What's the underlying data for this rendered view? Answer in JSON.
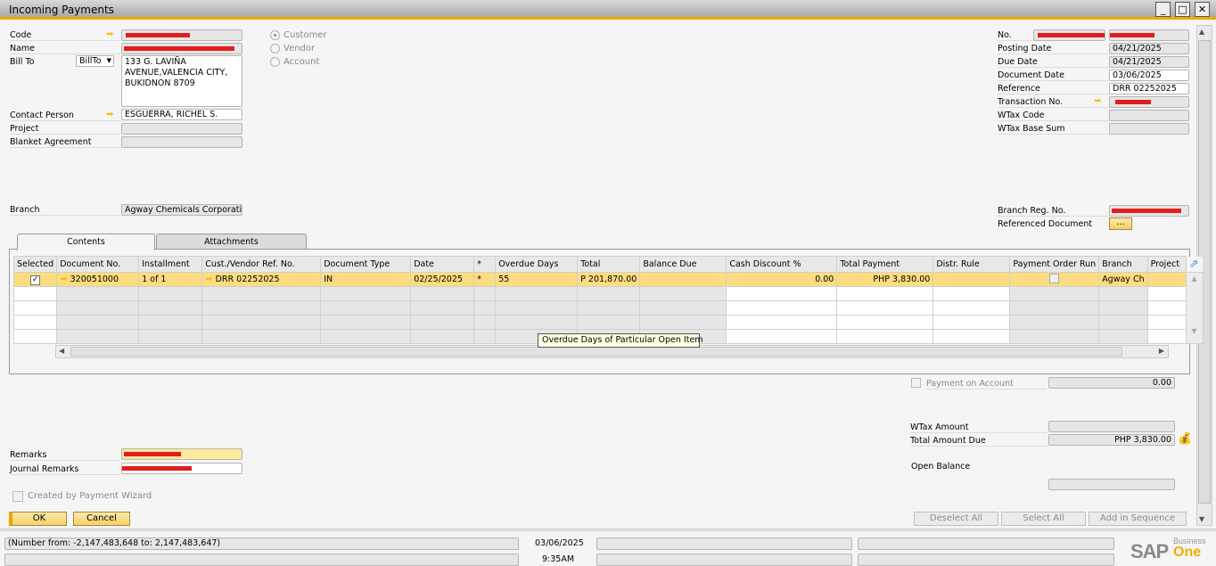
{
  "window": {
    "title": "Incoming Payments",
    "minimize": "_",
    "maximize": "□",
    "close": "✕"
  },
  "header_left": {
    "code_label": "Code",
    "name_label": "Name",
    "bill_to_label": "Bill To",
    "bill_to_select": "BillTo",
    "bill_to_address": [
      "133 G. LAVIÑA",
      "AVENUE,VALENCIA CITY,",
      "BUKIDNON 8709"
    ],
    "contact_label": "Contact Person",
    "contact_value": "ESGUERRA, RICHEL S.",
    "project_label": "Project",
    "blanket_label": "Blanket Agreement",
    "branch_label": "Branch",
    "branch_value": "Agway Chemicals Corporation"
  },
  "partner_type": {
    "options": [
      "Customer",
      "Vendor",
      "Account"
    ],
    "selected": "Customer"
  },
  "header_right": {
    "no_label": "No.",
    "posting_date_label": "Posting Date",
    "posting_date": "04/21/2025",
    "due_date_label": "Due Date",
    "due_date": "04/21/2025",
    "document_date_label": "Document Date",
    "document_date": "03/06/2025",
    "reference_label": "Reference",
    "reference": "DRR 02252025",
    "transaction_label": "Transaction No.",
    "wtax_code_label": "WTax Code",
    "wtax_base_label": "WTax Base Sum",
    "branch_reg_label": "Branch Reg. No.",
    "ref_doc_label": "Referenced Document",
    "ref_doc_button": "..."
  },
  "tabs": [
    {
      "label": "Contents"
    },
    {
      "label": "Attachments"
    }
  ],
  "grid": {
    "columns": [
      "Selected",
      "Document No.",
      "Installment",
      "Cust./Vendor Ref. No.",
      "Document Type",
      "Date",
      "*",
      "Overdue Days",
      "Total",
      "Balance Due",
      "Cash Discount %",
      "Total Payment",
      "Distr. Rule",
      "Payment Order Run",
      "Branch",
      "Project"
    ],
    "rows": [
      {
        "selected": true,
        "doc_no": "320051000",
        "installment": "1 of 1",
        "ref_no": "DRR 02252025",
        "doc_type": "IN",
        "date": "02/25/2025",
        "star": "*",
        "overdue": "55",
        "total": "P 201,870.00",
        "balance": "",
        "cash_disc": "0.00",
        "total_payment": "PHP 3,830.00",
        "distr": "",
        "por": false,
        "branch": "Agway Ch",
        "project": ""
      }
    ],
    "tooltip": "Overdue Days of Particular Open Item"
  },
  "totals": {
    "payment_on_account_label": "Payment on Account",
    "payment_on_account": "0.00",
    "wtax_amount_label": "WTax Amount",
    "total_due_label": "Total Amount Due",
    "total_due": "PHP 3,830.00",
    "open_balance_label": "Open Balance"
  },
  "footer": {
    "remarks_label": "Remarks",
    "journal_remarks_label": "Journal Remarks",
    "wizard_label": "Created by Payment Wizard",
    "ok": "OK",
    "cancel": "Cancel",
    "deselect_all": "Deselect All",
    "select_all": "Select All",
    "add_in_sequence": "Add in Sequence"
  },
  "statusbar": {
    "message": "(Number from: -2,147,483,648 to: 2,147,483,647)",
    "date": "03/06/2025",
    "time": "9:35AM",
    "logo_sap": "SAP",
    "logo_business": "Business",
    "logo_one": "One"
  }
}
